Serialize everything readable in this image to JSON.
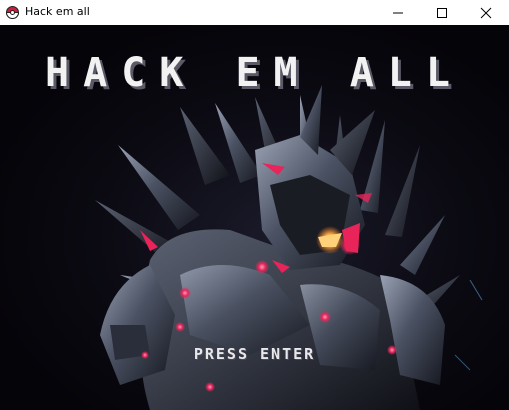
{
  "window": {
    "title": "Hack em all",
    "icon": "pokeball-icon",
    "controls": [
      "minimize-icon",
      "maximize-icon",
      "close-icon"
    ]
  },
  "game": {
    "title": "HACK EM ALL",
    "prompt": "PRESS ENTER",
    "background_color": "#06050a",
    "accent_color": "#e8245a",
    "eye_color": "#ffb347"
  }
}
